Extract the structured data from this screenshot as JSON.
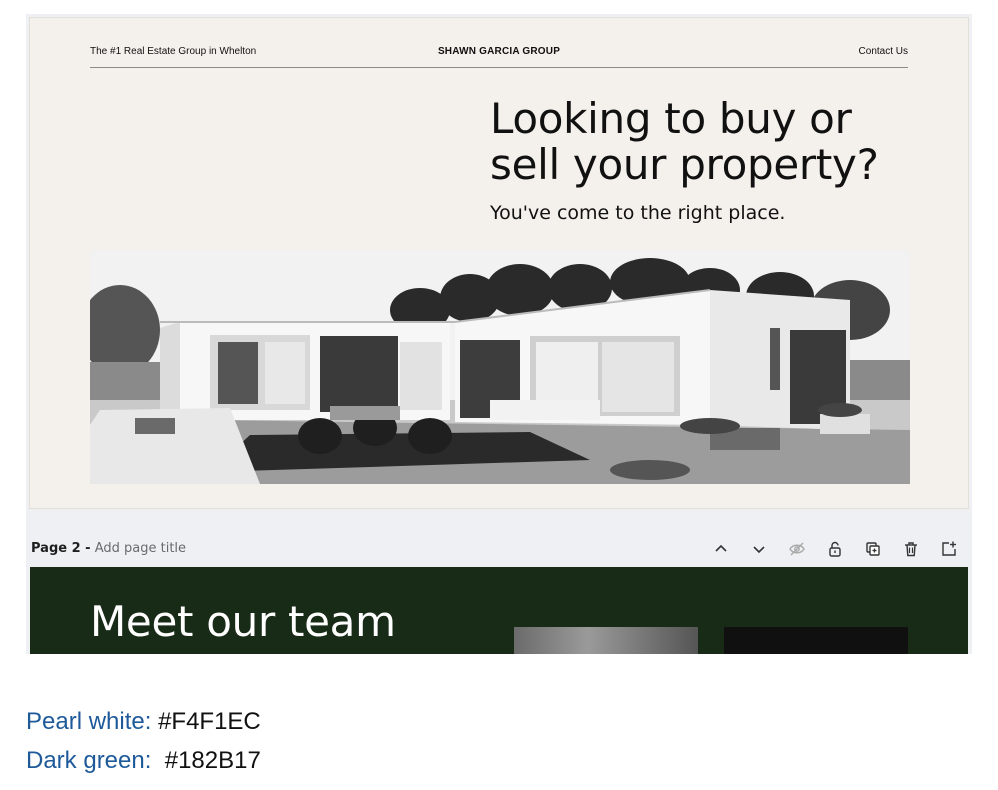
{
  "page1": {
    "header": {
      "tagline": "The #1 Real Estate Group in Whelton",
      "brand": "SHAWN GARCIA GROUP",
      "contact": "Contact Us"
    },
    "headline_line1": "Looking to buy or",
    "headline_line2": "sell your property?",
    "subheadline": "You've come to the right place."
  },
  "page_bar": {
    "page_label": "Page 2 -",
    "title_placeholder": "Add page title",
    "icons": [
      "chevron-up-icon",
      "chevron-down-icon",
      "hide-icon",
      "lock-icon",
      "duplicate-icon",
      "trash-icon",
      "add-page-icon"
    ]
  },
  "page2": {
    "heading": "Meet our team"
  },
  "swatches": [
    {
      "name": "Pearl white:",
      "hex": "#F4F1EC"
    },
    {
      "name": "Dark green:",
      "hex": "#182B17"
    }
  ],
  "colors": {
    "pearl_white": "#F4F1EC",
    "dark_green": "#182B17",
    "link_blue": "#1e5a9a"
  }
}
